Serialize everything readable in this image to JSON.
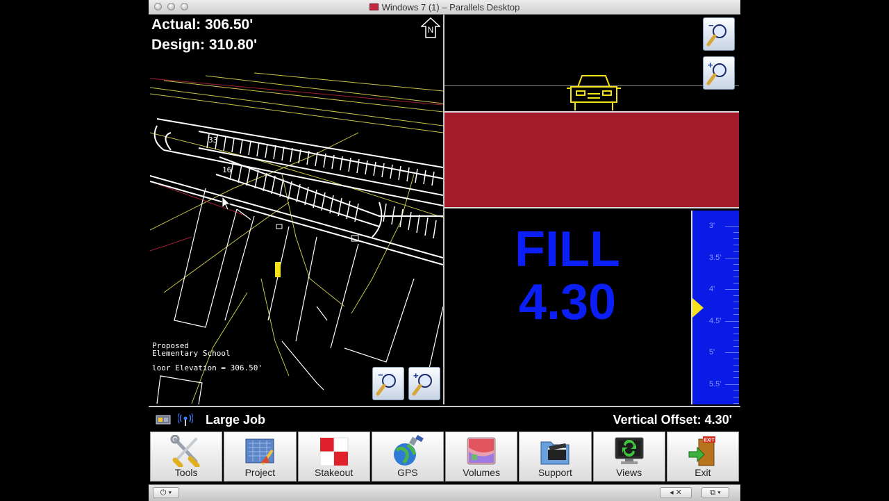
{
  "window": {
    "title": "Windows 7 (1) – Parallels Desktop"
  },
  "map": {
    "actual_label": "Actual: 306.50'",
    "design_label": "Design: 310.80'",
    "north_label": "N",
    "note_line1": "Proposed",
    "note_line2": "Elementary School",
    "note_line3": "loor Elevation = 306.50'",
    "lot_label_1": "33",
    "lot_label_2": "16"
  },
  "profile": {
    "status_word": "FILL",
    "status_value": "4.30",
    "scale_labels": [
      "3'",
      "3.5'",
      "4'",
      "4.5'",
      "5'",
      "5.5'"
    ],
    "pointer_value": 4.3,
    "colors": {
      "fill": "#a31a2b",
      "indicator": "#0a1ef5",
      "vehicle": "#f5e21a"
    }
  },
  "status": {
    "job_name": "Large Job",
    "vertical_offset": "Vertical Offset: 4.30'"
  },
  "toolbar": [
    {
      "label": "Tools",
      "icon": "tools-icon"
    },
    {
      "label": "Project",
      "icon": "project-icon"
    },
    {
      "label": "Stakeout",
      "icon": "stakeout-icon"
    },
    {
      "label": "GPS",
      "icon": "gps-icon"
    },
    {
      "label": "Volumes",
      "icon": "volumes-icon"
    },
    {
      "label": "Support",
      "icon": "support-icon"
    },
    {
      "label": "Views",
      "icon": "views-icon"
    },
    {
      "label": "Exit",
      "icon": "exit-icon"
    }
  ],
  "exit_sign": "EXIT"
}
